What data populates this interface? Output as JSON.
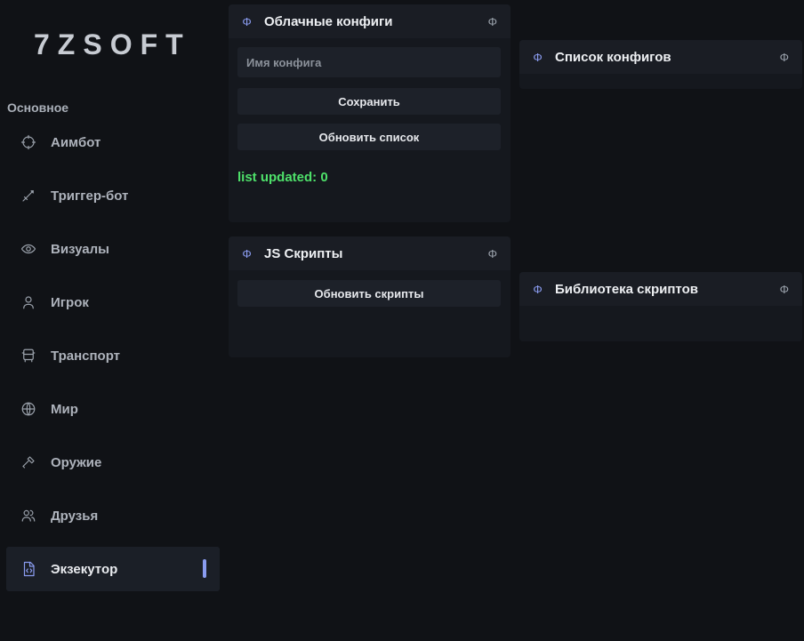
{
  "logo": "7ZSOFT",
  "sidebar": {
    "section_label": "Основное",
    "items": [
      {
        "label": "Аимбот",
        "icon": "crosshair-icon"
      },
      {
        "label": "Триггер-бот",
        "icon": "sword-icon"
      },
      {
        "label": "Визуалы",
        "icon": "eye-icon"
      },
      {
        "label": "Игрок",
        "icon": "user-icon"
      },
      {
        "label": "Транспорт",
        "icon": "car-icon"
      },
      {
        "label": "Мир",
        "icon": "globe-icon"
      },
      {
        "label": "Оружие",
        "icon": "hammer-icon"
      },
      {
        "label": "Друзья",
        "icon": "users-icon"
      },
      {
        "label": "Экзекутор",
        "icon": "file-code-icon",
        "active": true
      }
    ]
  },
  "panels": {
    "cloud_configs": {
      "title": "Облачные конфиги",
      "icon": "Φ",
      "name_placeholder": "Имя конфига",
      "name_value": "",
      "save_label": "Сохранить",
      "refresh_label": "Обновить список",
      "status": "list updated: 0",
      "status_color": "#4ee06a"
    },
    "config_list": {
      "title": "Список конфигов",
      "icon": "Φ"
    },
    "js_scripts": {
      "title": "JS Скрипты",
      "icon": "Φ",
      "refresh_label": "Обновить скрипты"
    },
    "script_library": {
      "title": "Библиотека скриптов",
      "icon": "Φ"
    }
  },
  "colors": {
    "background": "#101216",
    "accent": "#8a9cf0",
    "status_green": "#4ee06a"
  }
}
